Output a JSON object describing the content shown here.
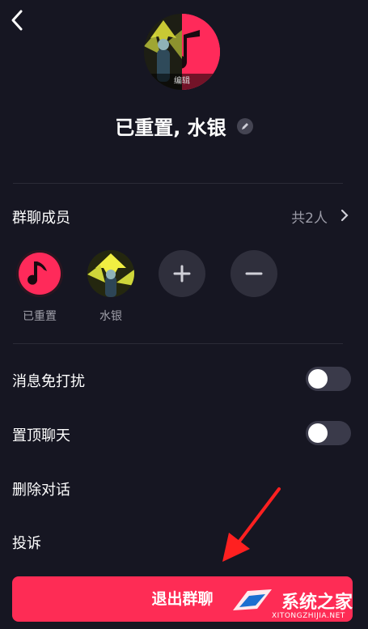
{
  "group": {
    "edit_caption": "编辑",
    "title": "已重置, 水银"
  },
  "members_section": {
    "label": "群聊成员",
    "count": "共2人",
    "members": [
      {
        "name": "已重置"
      },
      {
        "name": "水银"
      }
    ]
  },
  "settings": {
    "mute_label": "消息免打扰",
    "mute_on": false,
    "pin_label": "置顶聊天",
    "pin_on": false,
    "delete_label": "删除对话",
    "report_label": "投诉"
  },
  "exit_button": "退出群聊",
  "watermark": {
    "title": "系统之家",
    "url": "XITONGZHIJIA.NET"
  },
  "colors": {
    "background": "#161622",
    "accent": "#fe2c55",
    "arrow": "#ff2020"
  }
}
